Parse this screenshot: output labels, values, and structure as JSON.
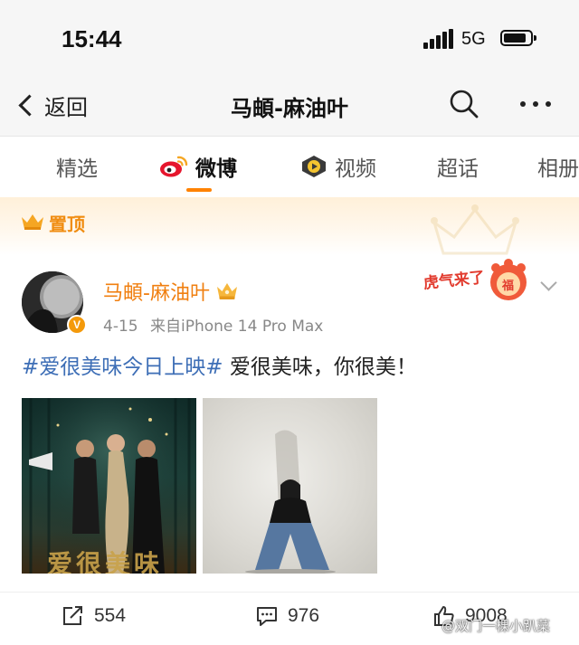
{
  "status_bar": {
    "time": "15:44",
    "network": "5G"
  },
  "nav": {
    "back_label": "返回",
    "title": "马頔-麻油叶"
  },
  "tabs": [
    {
      "label": "精选"
    },
    {
      "label": "微博"
    },
    {
      "label": "视频"
    },
    {
      "label": "超话"
    },
    {
      "label": "相册"
    }
  ],
  "pinned": {
    "label": "置顶"
  },
  "post": {
    "author": "马頔-麻油叶",
    "avatar_badge": "V",
    "date": "4-15",
    "source": "来自iPhone 14 Pro Max",
    "hashtag": "#爱很美味今日上映#",
    "text": " 爱很美味，你很美！",
    "sticker_text": "虎气来了",
    "sticker_icon_text": "福",
    "image1_caption": "爱很美味",
    "actions": {
      "repost_count": "554",
      "comment_count": "976",
      "like_count": "9008"
    }
  },
  "watermark": "@双门一棵小趴菜",
  "colors": {
    "accent": "#ff8200",
    "author_name": "#f07f10",
    "hashtag": "#3d6eb6",
    "pinned": "#f08c10"
  }
}
